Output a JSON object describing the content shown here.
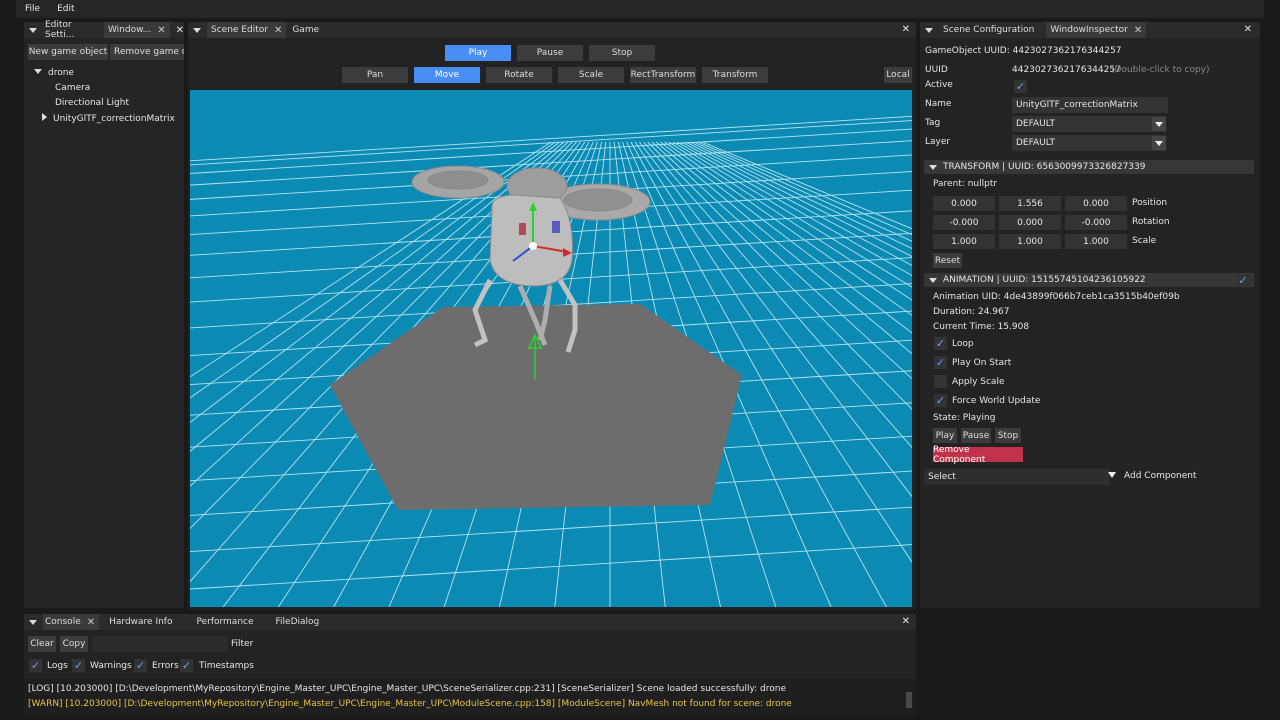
{
  "menu": {
    "file": "File",
    "edit": "Edit"
  },
  "left_panel": {
    "tabs": [
      "Editor Setti...",
      "Window..."
    ],
    "new_button": "New game object",
    "remove_button": "Remove game ol",
    "tree": {
      "root": "drone",
      "children": [
        "Camera",
        "Directional Light",
        "UnityGlTF_correctionMatrix"
      ]
    }
  },
  "scene": {
    "tabs": [
      "Scene Editor",
      "Game"
    ],
    "play": "Play",
    "pause": "Pause",
    "stop": "Stop",
    "tools": [
      "Pan",
      "Move",
      "Rotate",
      "Scale",
      "RectTransform",
      "Transform"
    ],
    "local": "Local",
    "colors": {
      "viewport": "#0b8ab3",
      "grid": "#d6f3fb",
      "ground": "#6d6d6d",
      "accent": "#4a8ef5"
    }
  },
  "inspector": {
    "tabs": [
      "Scene Configuration",
      "WindowInspector"
    ],
    "gameobject_uuid": "GameObject UUID: 4423027362176344257",
    "uuid_label": "UUID",
    "uuid_value": "4423027362176344257",
    "uuid_hint": "(Double-click to copy)",
    "active_label": "Active",
    "name_label": "Name",
    "name_value": "UnityGlTF_correctionMatrix",
    "tag_label": "Tag",
    "tag_value": "DEFAULT",
    "layer_label": "Layer",
    "layer_value": "DEFAULT",
    "transform_header": "TRANSFORM | UUID: 6563009973326827339",
    "parent": "Parent: nullptr",
    "position": [
      "0.000",
      "1.556",
      "0.000"
    ],
    "position_label": "Position",
    "rotation": [
      "-0.000",
      "0.000",
      "-0.000"
    ],
    "rotation_label": "Rotation",
    "scale": [
      "1.000",
      "1.000",
      "1.000"
    ],
    "scale_label": "Scale",
    "reset": "Reset",
    "animation_header": "ANIMATION | UUID: 15155745104236105922",
    "animation_uid": "Animation UID: 4de43899f066b7ceb1ca3515b40ef09b",
    "duration": "Duration: 24.967",
    "current_time": "Current Time: 15.908",
    "loop": "Loop",
    "play_on_start": "Play On Start",
    "apply_scale": "Apply Scale",
    "force_world_update": "Force World Update",
    "state": "State: Playing",
    "play": "Play",
    "pause": "Pause",
    "stop": "Stop",
    "remove_component": "Remove Component",
    "select": "Select",
    "add_component": "Add Component"
  },
  "console": {
    "tabs": [
      "Console",
      "Hardware Info",
      "Performance",
      "FileDialog"
    ],
    "clear": "Clear",
    "copy": "Copy",
    "filter": "Filter",
    "filters": [
      "Logs",
      "Warnings",
      "Errors",
      "Timestamps"
    ],
    "log_line": "[LOG] [10.203000] [D:\\Development\\MyRepository\\Engine_Master_UPC\\Engine_Master_UPC\\SceneSerializer.cpp:231] [SceneSerializer] Scene loaded successfully: drone",
    "warn_line": "[WARN] [10.203000] [D:\\Development\\MyRepository\\Engine_Master_UPC\\Engine_Master_UPC\\ModuleScene.cpp:158] [ModuleScene] NavMesh not found for scene: drone",
    "warn_color": "#e8c14a"
  }
}
